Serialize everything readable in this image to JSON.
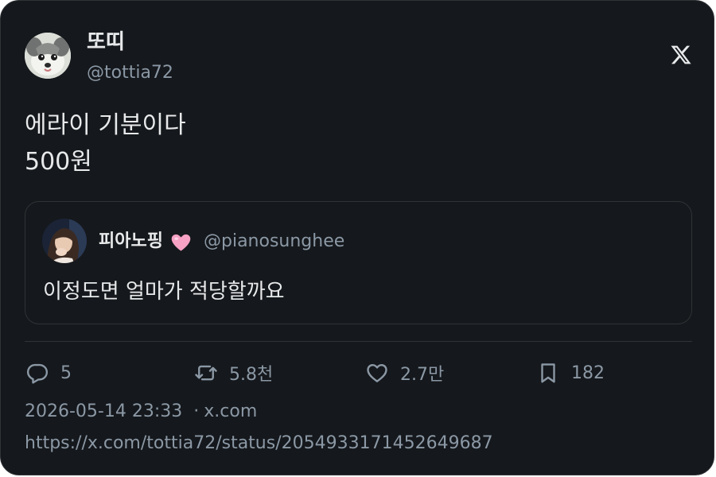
{
  "author": {
    "display_name": "또띠",
    "handle": "@tottia72",
    "avatar_icon": "dog-avatar"
  },
  "tweet": {
    "text_lines": [
      "에라이 기분이다",
      "500원"
    ]
  },
  "quoted_tweet": {
    "display_name": "피아노핑",
    "name_emoji": "pink-heart-icon",
    "handle": "@pianosunghee",
    "text": "이정도면 얼마가 적당할까요",
    "avatar_icon": "person-avatar"
  },
  "actions": {
    "reply_count": "5",
    "retweet_count": "5.8천",
    "like_count": "2.7만",
    "bookmark_count": "182"
  },
  "meta": {
    "timestamp": "2026-05-14 23:33",
    "separator": "·",
    "source": "x.com",
    "url": "https://x.com/tottia72/status/2054933171452649687"
  },
  "colors": {
    "background": "#15181c",
    "primary_text": "#e7e9ea",
    "secondary_text": "#8b98a5",
    "border": "#2f3336",
    "heart_emoji": "#f7a1c4"
  }
}
